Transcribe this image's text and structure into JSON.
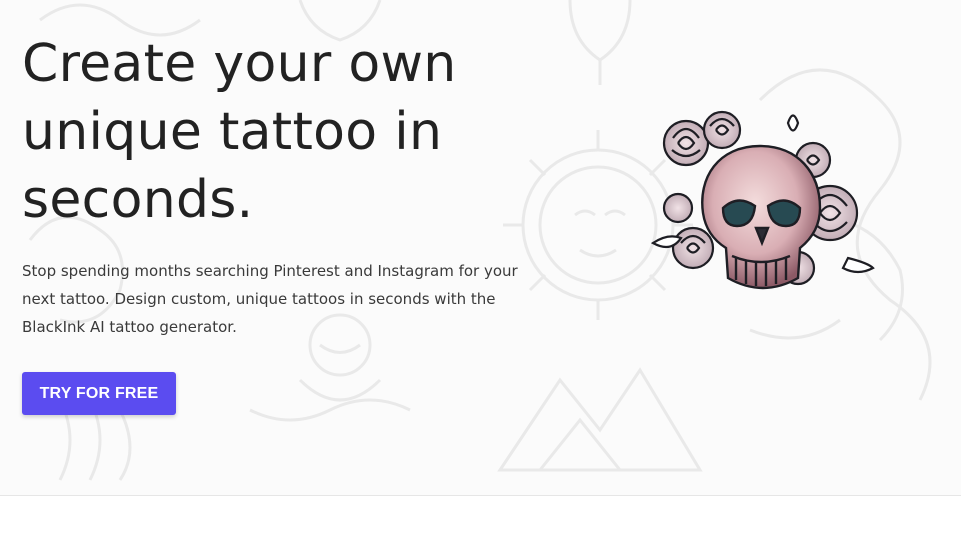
{
  "hero": {
    "headline": "Create your own unique tattoo in seconds.",
    "subtext": "Stop spending months searching Pinterest and Instagram for your next tattoo. Design custom, unique tattoos in seconds with the BlackInk AI tattoo generator.",
    "cta_label": "TRY FOR FREE",
    "image_subject": "skull-and-roses-tattoo-icon"
  },
  "colors": {
    "accent": "#5b4cf0",
    "headline": "#222222",
    "body_text": "#3a3a3a",
    "background": "#fbfbfb"
  }
}
